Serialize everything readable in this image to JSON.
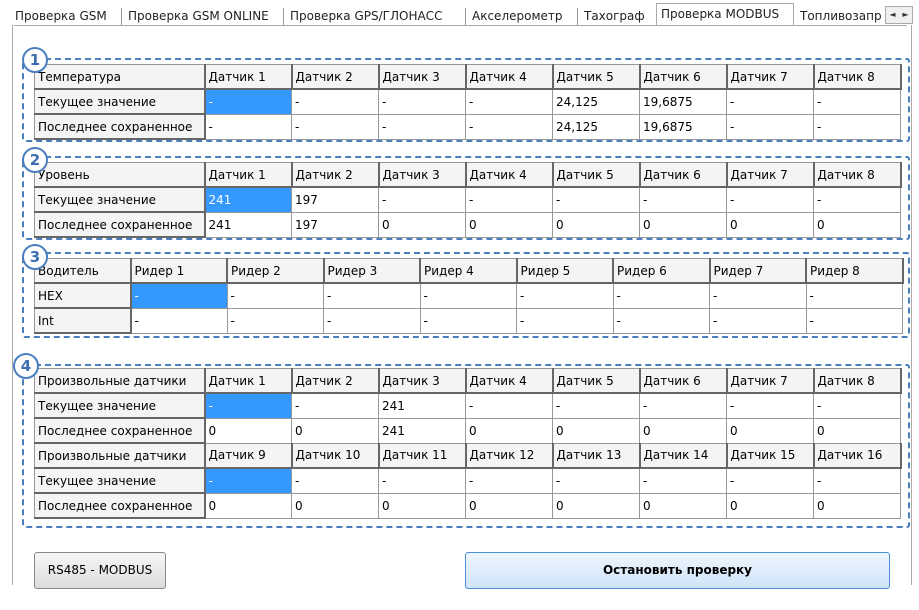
{
  "tabs": [
    {
      "label": "Проверка GSM"
    },
    {
      "label": "Проверка GSM ONLINE"
    },
    {
      "label": "Проверка GPS/ГЛОНАСС"
    },
    {
      "label": "Акселерометр"
    },
    {
      "label": "Тахограф"
    },
    {
      "label": "Проверка MODBUS",
      "active": true
    },
    {
      "label": "Топливозапр"
    }
  ],
  "tab_scroll": {
    "left": "◄",
    "right": "►"
  },
  "groups": [
    {
      "number": "1",
      "header": [
        "Температура",
        "Датчик 1",
        "Датчик 2",
        "Датчик 3",
        "Датчик 4",
        "Датчик 5",
        "Датчик 6",
        "Датчик 7",
        "Датчик 8"
      ],
      "rows": [
        [
          "Текущее значение",
          "-",
          "-",
          "-",
          "-",
          "24,125",
          "19,6875",
          "-",
          "-"
        ],
        [
          "Последнее сохраненное",
          "-",
          "-",
          "-",
          "-",
          "24,125",
          "19,6875",
          "-",
          "-"
        ]
      ]
    },
    {
      "number": "2",
      "header": [
        "Уровень",
        "Датчик 1",
        "Датчик 2",
        "Датчик 3",
        "Датчик 4",
        "Датчик 5",
        "Датчик 6",
        "Датчик 7",
        "Датчик 8"
      ],
      "rows": [
        [
          "Текущее значение",
          "241",
          "197",
          "-",
          "-",
          "-",
          "-",
          "-",
          "-"
        ],
        [
          "Последнее сохраненное",
          "241",
          "197",
          "0",
          "0",
          "0",
          "0",
          "0",
          "0"
        ]
      ]
    },
    {
      "number": "3",
      "header": [
        "Водитель",
        "Ридер 1",
        "Ридер 2",
        "Ридер 3",
        "Ридер 4",
        "Ридер 5",
        "Ридер 6",
        "Ридер 7",
        "Ридер 8"
      ],
      "rows": [
        [
          "HEX",
          "-",
          "-",
          "-",
          "-",
          "-",
          "-",
          "-",
          "-"
        ],
        [
          "Int",
          "-",
          "-",
          "-",
          "-",
          "-",
          "-",
          "-",
          "-"
        ]
      ]
    },
    {
      "number": "4",
      "header": [
        "Произвольные датчики",
        "Датчик 1",
        "Датчик 2",
        "Датчик 3",
        "Датчик 4",
        "Датчик 5",
        "Датчик 6",
        "Датчик 7",
        "Датчик 8"
      ],
      "rows": [
        [
          "Текущее значение",
          "-",
          "-",
          "241",
          "-",
          "-",
          "-",
          "-",
          "-"
        ],
        [
          "Последнее сохраненное",
          "0",
          "0",
          "241",
          "0",
          "0",
          "0",
          "0",
          "0"
        ]
      ],
      "header2": [
        "Произвольные датчики",
        "Датчик 9",
        "Датчик 10",
        "Датчик 11",
        "Датчик 12",
        "Датчик 13",
        "Датчик 14",
        "Датчик 15",
        "Датчик 16"
      ],
      "rows2": [
        [
          "Текущее значение",
          "-",
          "-",
          "-",
          "-",
          "-",
          "-",
          "-",
          "-"
        ],
        [
          "Последнее сохраненное",
          "0",
          "0",
          "0",
          "0",
          "0",
          "0",
          "0",
          "0"
        ]
      ]
    }
  ],
  "buttons": {
    "rs485": "RS485 - MODBUS",
    "stop": "Остановить проверку"
  }
}
